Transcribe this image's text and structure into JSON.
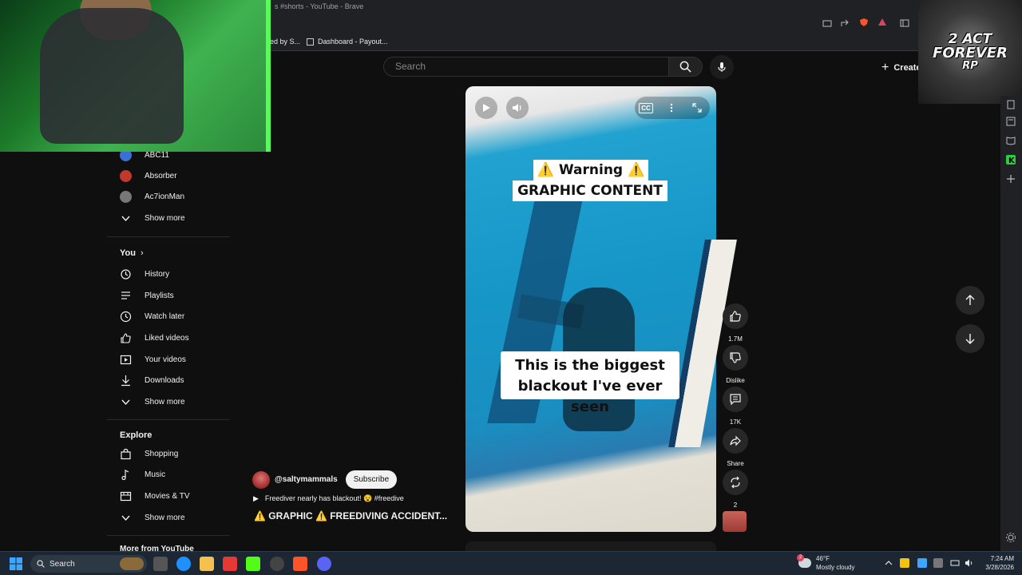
{
  "browser": {
    "window_title": "s #shorts - YouTube - Brave",
    "bookmarks": [
      {
        "label": "ed by S..."
      },
      {
        "label": "Dashboard - Payout..."
      }
    ]
  },
  "overlay": {
    "logo_line1": "2 ACT",
    "logo_line2": "FOREVER",
    "logo_line3": "RP"
  },
  "header": {
    "search_placeholder": "Search",
    "create_label": "Create"
  },
  "sidebar": {
    "subscriptions": [
      {
        "label": "ABC11"
      },
      {
        "label": "Absorber"
      },
      {
        "label": "Ac7ionMan"
      }
    ],
    "show_more_1": "Show more",
    "you_title": "You",
    "you_items": [
      {
        "label": "History",
        "icon": "history-icon"
      },
      {
        "label": "Playlists",
        "icon": "playlists-icon"
      },
      {
        "label": "Watch later",
        "icon": "clock-icon"
      },
      {
        "label": "Liked videos",
        "icon": "thumbs-up-icon"
      },
      {
        "label": "Your videos",
        "icon": "play-square-icon"
      },
      {
        "label": "Downloads",
        "icon": "download-icon"
      }
    ],
    "show_more_2": "Show more",
    "explore_title": "Explore",
    "explore_items": [
      {
        "label": "Shopping",
        "icon": "shopping-bag-icon"
      },
      {
        "label": "Music",
        "icon": "music-note-icon"
      },
      {
        "label": "Movies & TV",
        "icon": "film-icon"
      }
    ],
    "show_more_3": "Show more",
    "more_from": "More from YouTube"
  },
  "video": {
    "caption_line1": "⚠️ Warning ⚠️",
    "caption_line2": "GRAPHIC CONTENT",
    "caption_bottom_1": "This is the biggest",
    "caption_bottom_2": "blackout I've ever seen",
    "cc_label": "CC"
  },
  "actions": {
    "likes": "1.7M",
    "dislike": "Dislike",
    "comments": "17K",
    "share": "Share",
    "remix": "2"
  },
  "channel": {
    "handle": "@saltymammals",
    "subscribe": "Subscribe",
    "description": "Freediver nearly has blackout! 😵 #freedive",
    "title": "⚠️ GRAPHIC ⚠️ FREEDIVING ACCIDENT..."
  },
  "taskbar": {
    "search_label": "Search",
    "weather_temp": "46°F",
    "weather_desc": "Mostly cloudy",
    "time": "7:24 AM",
    "date": "3/28/2026",
    "weather_badge": "2"
  }
}
